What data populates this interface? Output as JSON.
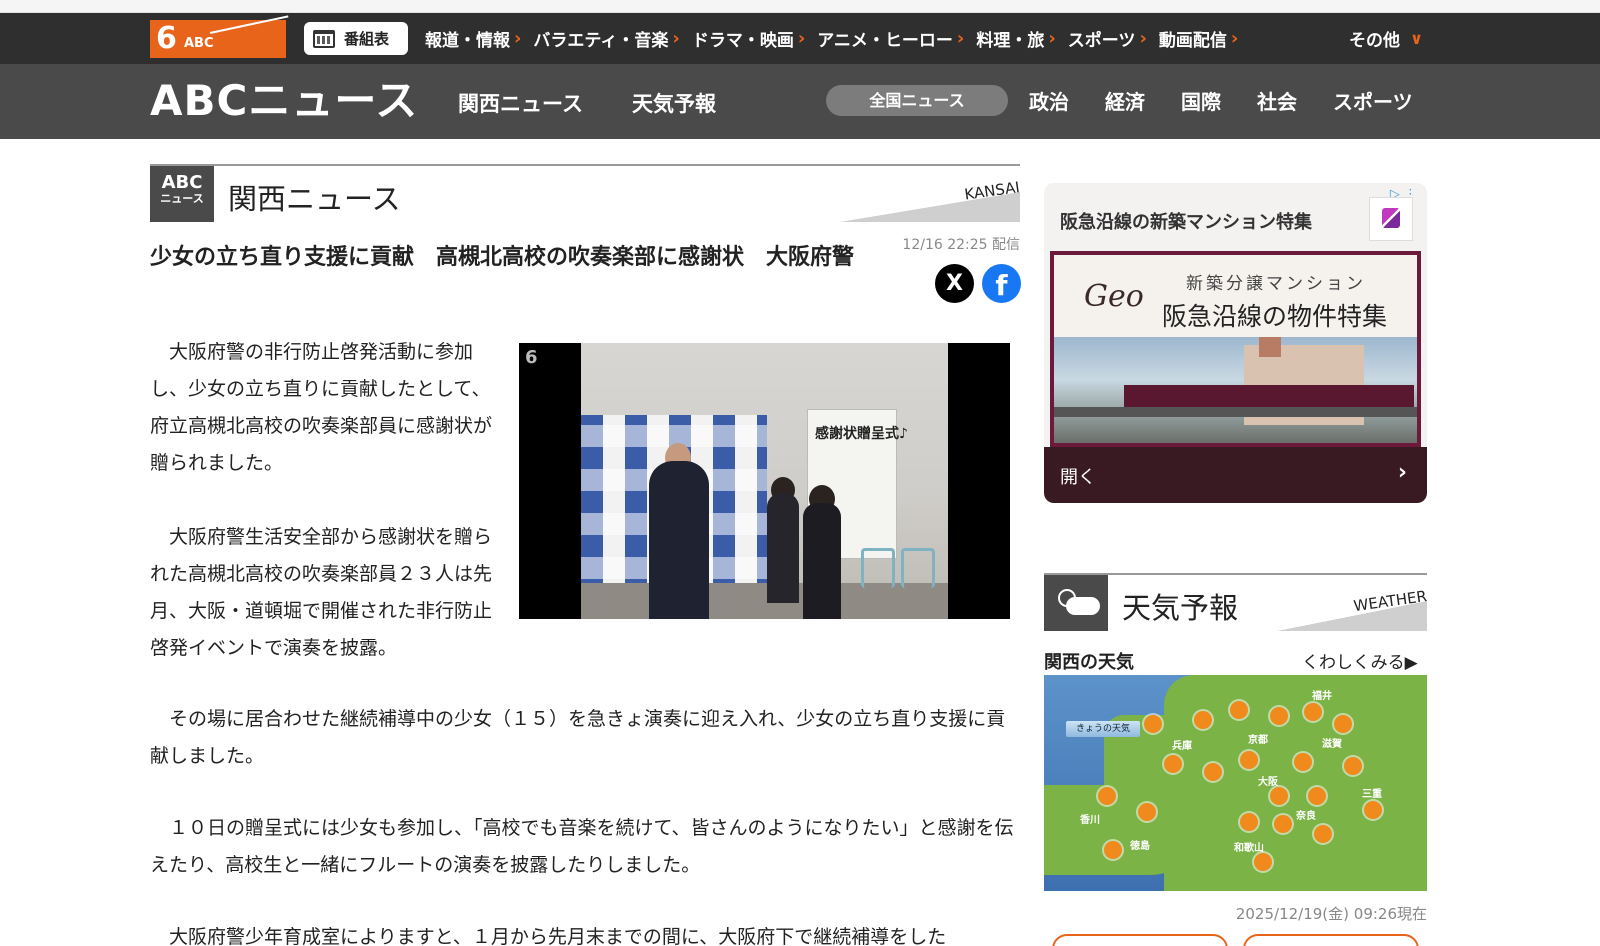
{
  "global_nav": {
    "logo_text": "6 ABC",
    "program_button": "番組表",
    "items": [
      {
        "label": "報道・情報"
      },
      {
        "label": "バラエティ・音楽"
      },
      {
        "label": "ドラマ・映画"
      },
      {
        "label": "アニメ・ヒーロー"
      },
      {
        "label": "料理・旅"
      },
      {
        "label": "スポーツ"
      },
      {
        "label": "動画配信"
      }
    ],
    "other": "その他"
  },
  "news_header": {
    "logo": "ABCニュース",
    "links": [
      "関西ニュース",
      "天気予報"
    ],
    "categories": [
      {
        "label": "全国ニュース",
        "active": true
      },
      {
        "label": "政治"
      },
      {
        "label": "経済"
      },
      {
        "label": "国際"
      },
      {
        "label": "社会"
      },
      {
        "label": "スポーツ"
      }
    ]
  },
  "section": {
    "badge_top": "ABC",
    "badge_bottom": "ニュース",
    "title": "関西ニュース",
    "english": "KANSAI"
  },
  "article": {
    "title": "少女の立ち直り支援に貢献　高槻北高校の吹奏楽部に感謝状　大阪府警",
    "date": "12/16 22:25 配信",
    "share": {
      "x": "X",
      "facebook": "f"
    },
    "photo_caption_text": "感謝状贈呈式♪",
    "paragraphs": [
      "　大阪府警の非行防止啓発活動に参加し、少女の立ち直りに貢献したとして、府立高槻北高校の吹奏楽部員に感謝状が贈られました。",
      "　大阪府警生活安全部から感謝状を贈られた高槻北高校の吹奏楽部員２３人は先月、大阪・道頓堀で開催された非行防止啓発イベントで演奏を披露。",
      "　その場に居合わせた継続補導中の少女（１５）を急きょ演奏に迎え入れ、少女の立ち直り支援に貢献しました。",
      "　１０日の贈呈式には少女も参加し、「高校でも音楽を続けて、皆さんのようになりたい」と感謝を伝えたり、高校生と一緒にフルートの演奏を披露したりしました。",
      "　大阪府警少年育成室によりますと、１月から先月末までの間に、大阪府下で継続補導をした"
    ]
  },
  "ad": {
    "headline": "阪急沿線の新築マンション特集",
    "brand": "Geo",
    "line1": "新築分譲マンション",
    "line2": "阪急沿線の物件特集",
    "open": "開く"
  },
  "weather": {
    "title": "天気予報",
    "english": "WEATHER",
    "region": "関西の天気",
    "more": "くわしくみる▶",
    "map_tag": "きょうの天気",
    "prefectures": [
      "福井",
      "兵庫",
      "京都",
      "滋賀",
      "大阪",
      "三重",
      "香川",
      "奈良",
      "徳島",
      "和歌山"
    ],
    "updated": "2025/12/19(金) 09:26現在"
  },
  "colors": {
    "brand_orange": "#e8641b",
    "nav_dark": "#2f2f2f",
    "header_gray": "#4b4a4b",
    "facebook": "#1877f2"
  }
}
